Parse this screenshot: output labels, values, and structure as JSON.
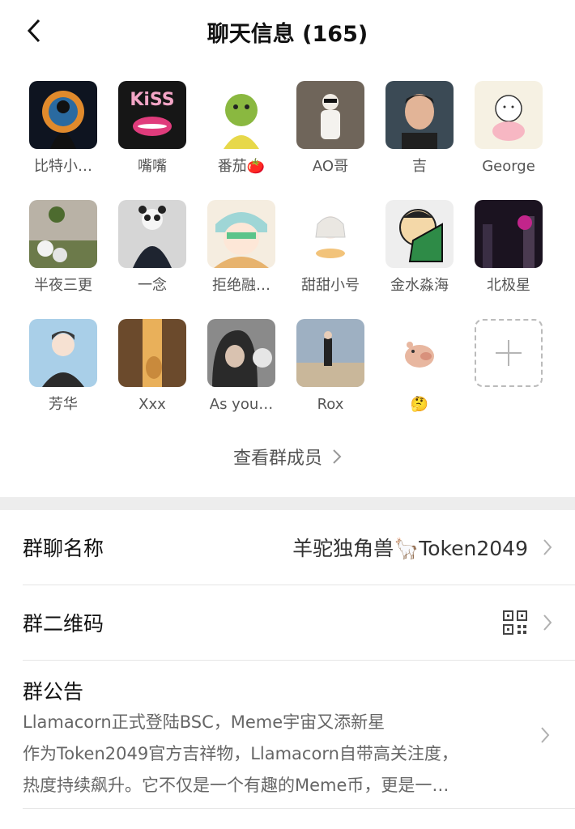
{
  "header": {
    "title": "聊天信息 (165)"
  },
  "members": [
    {
      "name": "比特小…",
      "avatar": "bitcoin-silhouette"
    },
    {
      "name": "嘴嘴",
      "avatar": "kiss-lips"
    },
    {
      "name": "番茄🍅",
      "avatar": "cartoon-ogre"
    },
    {
      "name": "AO哥",
      "avatar": "white-suit-figure"
    },
    {
      "name": "吉",
      "avatar": "man-portrait"
    },
    {
      "name": "George",
      "avatar": "dog-sketch"
    },
    {
      "name": "半夜三更",
      "avatar": "flower-garden"
    },
    {
      "name": "一念",
      "avatar": "panda-man"
    },
    {
      "name": "拒绝融…",
      "avatar": "anime-girl"
    },
    {
      "name": "甜甜小号",
      "avatar": "chibi-girl"
    },
    {
      "name": "金水淼海",
      "avatar": "cabbage-cartoon"
    },
    {
      "name": "北极星",
      "avatar": "night-city"
    },
    {
      "name": "芳华",
      "avatar": "anime-man"
    },
    {
      "name": "Xxx",
      "avatar": "cat-alley"
    },
    {
      "name": "As you…",
      "avatar": "hooded-cat"
    },
    {
      "name": "Rox",
      "avatar": "beach-figure"
    },
    {
      "name": "🤔",
      "avatar": "pig-sticker"
    }
  ],
  "view_all": "查看群成员",
  "group_name": {
    "label": "群聊名称",
    "value": "羊驼独角兽🦙Token2049"
  },
  "qr_code": {
    "label": "群二维码"
  },
  "announcement": {
    "label": "群公告",
    "lines": [
      "Llamacorn正式登陆BSC，Meme宇宙又添新星",
      "作为Token2049官方吉祥物，Llamacorn自带高关注度，",
      "热度持续飙升。它不仅是一个有趣的Meme币，更是一…"
    ]
  },
  "colors": {
    "separator": "#ededed",
    "text_secondary": "#666666",
    "chevron": "#b0b0b0"
  }
}
